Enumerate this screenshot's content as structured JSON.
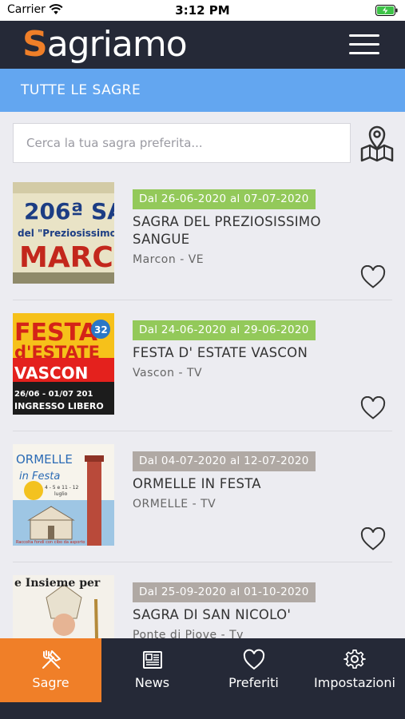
{
  "status_bar": {
    "carrier": "Carrier",
    "time": "3:12 PM"
  },
  "header": {
    "logo_first": "S",
    "logo_rest": "agriamo"
  },
  "section": {
    "title": "TUTTE LE SAGRE"
  },
  "search": {
    "placeholder": "Cerca la tua sagra preferita..."
  },
  "events": [
    {
      "date": "Dal 26-06-2020 al 07-07-2020",
      "date_color": "#93c95a",
      "title_lines": [
        "SAGRA DEL PREZIOSISSIMO",
        "SANGUE"
      ],
      "location": "Marcon - VE",
      "thumb_text": [
        "206ª SA",
        "del \"Preziosissimo",
        "MARC"
      ]
    },
    {
      "date": "Dal 24-06-2020 al 29-06-2020",
      "date_color": "#93c95a",
      "title_lines": [
        "FESTA D' ESTATE VASCON"
      ],
      "location": "Vascon - TV",
      "thumb_text": [
        "FESTA",
        "d'ESTATE",
        "VASCON",
        "26/06 - 01/07 201",
        "INGRESSO LIBERO",
        "32"
      ]
    },
    {
      "date": "Dal 04-07-2020 al 12-07-2020",
      "date_color": "#b0a9a4",
      "title_lines": [
        "ORMELLE IN FESTA"
      ],
      "location": "ORMELLE - TV",
      "thumb_text": [
        "ORMELLE",
        "in Festa",
        "4 - 5 e 11 - 12",
        "luglio",
        "Raccolta fondi con cibo da asporto"
      ]
    },
    {
      "date": "Dal 25-09-2020 al 01-10-2020",
      "date_color": "#b0a9a4",
      "title_lines": [
        "SAGRA DI SAN NICOLO'"
      ],
      "location": "Ponte di Piove - Tv",
      "thumb_text": [
        "e Insieme per"
      ]
    }
  ],
  "tabs": [
    {
      "label": "Sagre",
      "icon": "fork-knife-icon",
      "active": true
    },
    {
      "label": "News",
      "icon": "newspaper-icon",
      "active": false
    },
    {
      "label": "Preferiti",
      "icon": "heart-icon",
      "active": false
    },
    {
      "label": "Impostazioni",
      "icon": "gear-icon",
      "active": false
    }
  ],
  "colors": {
    "header": "#252937",
    "accent": "#f07f28",
    "section_bar": "#63a6f0",
    "date_active": "#93c95a",
    "date_inactive": "#b0a9a4"
  }
}
